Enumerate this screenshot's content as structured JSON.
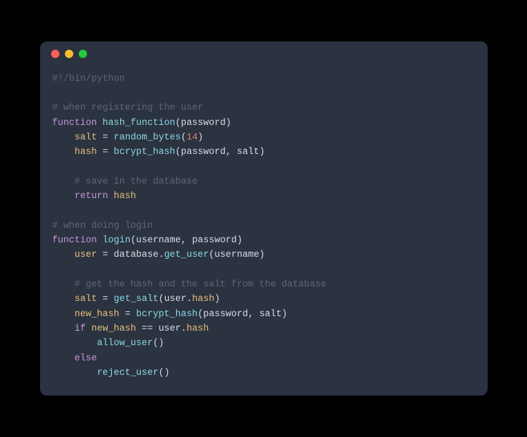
{
  "traffic_lights": {
    "red": "#ff5f56",
    "yellow": "#ffbd2e",
    "green": "#27c93f"
  },
  "code": {
    "l1": "#!/bin/python",
    "l3": "# when registering the user",
    "l4_k1": "function",
    "l4_fn": "hash_function",
    "l4_p1": "password",
    "l5_v": "salt",
    "l5_fn": "random_bytes",
    "l5_n": "14",
    "l6_v": "hash",
    "l6_fn": "bcrypt_hash",
    "l6_a1": "password",
    "l6_a2": "salt",
    "l8": "# save in the database",
    "l9_k": "return",
    "l9_v": "hash",
    "l11": "# when doing login",
    "l12_k": "function",
    "l12_fn": "login",
    "l12_a1": "username",
    "l12_a2": "password",
    "l13_v": "user",
    "l13_o": "database",
    "l13_fn": "get_user",
    "l13_a": "username",
    "l15": "# get the hash and the salt from the database",
    "l16_v": "salt",
    "l16_fn": "get_salt",
    "l16_o": "user",
    "l16_p": "hash",
    "l17_v": "new_hash",
    "l17_fn": "bcrypt_hash",
    "l17_a1": "password",
    "l17_a2": "salt",
    "l18_k": "if",
    "l18_a": "new_hash",
    "l18_op": "==",
    "l18_o": "user",
    "l18_p": "hash",
    "l19_fn": "allow_user",
    "l20_k": "else",
    "l21_fn": "reject_user"
  }
}
